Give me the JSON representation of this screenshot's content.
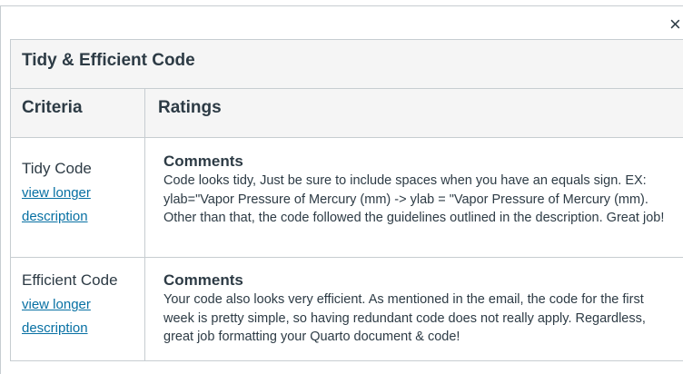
{
  "dialog": {
    "close_glyph": "×"
  },
  "rubric": {
    "title": "Tidy & Efficient Code",
    "headers": {
      "criteria": "Criteria",
      "ratings": "Ratings"
    },
    "rows": [
      {
        "criterion": "Tidy Code",
        "link": "view longer description",
        "comments_label": "Comments",
        "comments": "Code looks tidy, Just be sure to include spaces when you have an equals sign. EX: ylab=\"Vapor Pressure of Mercury (mm) -> ylab = \"Vapor Pressure of Mercury (mm). Other than that, the code followed the guidelines outlined in the description. Great job!"
      },
      {
        "criterion": "Efficient Code",
        "link": "view longer description",
        "comments_label": "Comments",
        "comments": "Your code also looks very efficient. As mentioned in the email, the code for the first week is pretty simple, so having redundant code does not really apply. Regardless, great job formatting your Quarto document & code!"
      }
    ]
  }
}
